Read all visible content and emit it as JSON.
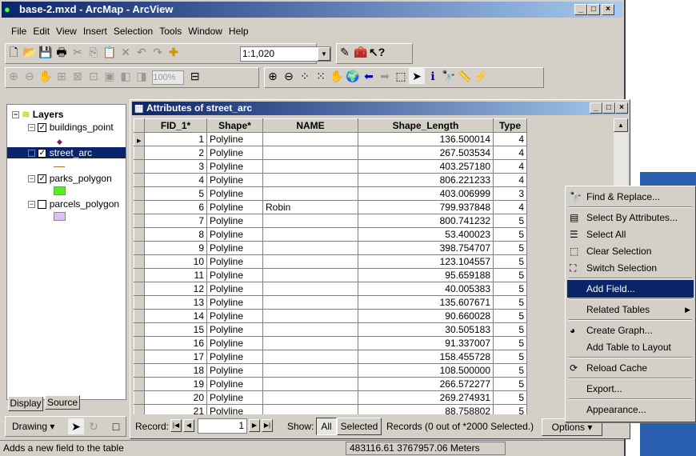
{
  "app": {
    "title": "base-2.mxd - ArcMap - ArcView"
  },
  "menu": [
    "File",
    "Edit",
    "View",
    "Insert",
    "Selection",
    "Tools",
    "Window",
    "Help"
  ],
  "toolbar": {
    "scale": "1:1,020",
    "zoom_pct": "100%"
  },
  "toc": {
    "root": "Layers",
    "layers": [
      {
        "name": "buildings_point",
        "checked": true,
        "symbol": "point",
        "color": "#7a1a5a"
      },
      {
        "name": "street_arc",
        "checked": true,
        "symbol": "line",
        "color": "#b07030",
        "selected": true
      },
      {
        "name": "parks_polygon",
        "checked": true,
        "symbol": "fill",
        "color": "#55ee22"
      },
      {
        "name": "parcels_polygon",
        "checked": false,
        "symbol": "fill",
        "color": "#e0c0f0"
      }
    ],
    "tabs": [
      "Display",
      "Source"
    ]
  },
  "drawing": {
    "label": "Drawing"
  },
  "attributes": {
    "title": "Attributes of street_arc",
    "columns": [
      "FID_1*",
      "Shape*",
      "NAME",
      "Shape_Length",
      "Type"
    ],
    "rows": [
      [
        1,
        "Polyline",
        "",
        "136.500014",
        4
      ],
      [
        2,
        "Polyline",
        "",
        "267.503534",
        4
      ],
      [
        3,
        "Polyline",
        "",
        "403.257180",
        4
      ],
      [
        4,
        "Polyline",
        "",
        "806.221233",
        4
      ],
      [
        5,
        "Polyline",
        "",
        "403.006999",
        3
      ],
      [
        6,
        "Polyline",
        "Robin",
        "799.937848",
        4
      ],
      [
        7,
        "Polyline",
        "",
        "800.741232",
        5
      ],
      [
        8,
        "Polyline",
        "",
        "53.400023",
        5
      ],
      [
        9,
        "Polyline",
        "",
        "398.754707",
        5
      ],
      [
        10,
        "Polyline",
        "",
        "123.104557",
        5
      ],
      [
        11,
        "Polyline",
        "",
        "95.659188",
        5
      ],
      [
        12,
        "Polyline",
        "",
        "40.005383",
        5
      ],
      [
        13,
        "Polyline",
        "",
        "135.607671",
        5
      ],
      [
        14,
        "Polyline",
        "",
        "90.660028",
        5
      ],
      [
        15,
        "Polyline",
        "",
        "30.505183",
        5
      ],
      [
        16,
        "Polyline",
        "",
        "91.337007",
        5
      ],
      [
        17,
        "Polyline",
        "",
        "158.455728",
        5
      ],
      [
        18,
        "Polyline",
        "",
        "108.500000",
        5
      ],
      [
        19,
        "Polyline",
        "",
        "266.572277",
        5
      ],
      [
        20,
        "Polyline",
        "",
        "269.274931",
        5
      ],
      [
        21,
        "Polyline",
        "",
        "88.758802",
        5
      ]
    ],
    "record_label": "Record:",
    "record_value": "1",
    "show_label": "Show:",
    "show_all": "All",
    "show_selected": "Selected",
    "records_text": "Records  (0 out of *2000 Selected.)",
    "options": "Options"
  },
  "context_menu": [
    {
      "label": "Find & Replace...",
      "icon": "binoculars-icon"
    },
    {
      "label": "Select By Attributes...",
      "icon": "sql-icon"
    },
    {
      "label": "Select All",
      "icon": "select-all-icon"
    },
    {
      "label": "Clear Selection",
      "icon": "clear-selection-icon"
    },
    {
      "label": "Switch Selection",
      "icon": "switch-selection-icon"
    },
    {
      "label": "Add Field...",
      "highlighted": true
    },
    {
      "label": "Related Tables",
      "submenu": true
    },
    {
      "label": "Create Graph...",
      "icon": "graph-icon"
    },
    {
      "label": "Add Table to Layout"
    },
    {
      "label": "Reload Cache",
      "icon": "reload-icon"
    },
    {
      "label": "Export..."
    },
    {
      "label": "Appearance..."
    }
  ],
  "status": {
    "message": "Adds a new field to the table",
    "coords": "483116.61  3767957.06 Meters"
  }
}
